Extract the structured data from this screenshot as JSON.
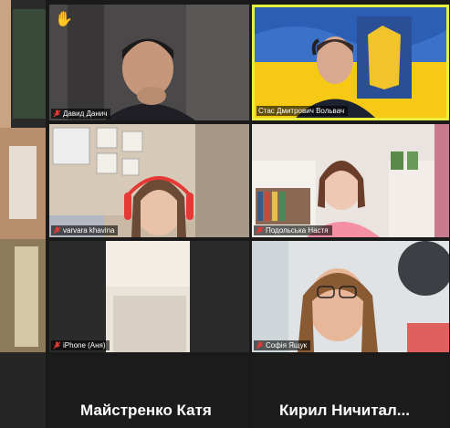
{
  "tiles": [
    {
      "name": "Давид Данич",
      "muted": true,
      "raised_hand": true,
      "active": false
    },
    {
      "name": "Стас Дмитрович Вольвач",
      "muted": false,
      "raised_hand": false,
      "active": true
    },
    {
      "name": "varvara khavina",
      "muted": true,
      "raised_hand": false,
      "active": false
    },
    {
      "name": "Подольська Настя",
      "muted": true,
      "raised_hand": false,
      "active": false
    },
    {
      "name": "iPhone (Аня)",
      "muted": true,
      "raised_hand": false,
      "active": false
    },
    {
      "name": "Софія Ящук",
      "muted": true,
      "raised_hand": false,
      "active": false
    }
  ],
  "video_off_tiles": [
    {
      "name": "Майстренко Катя"
    },
    {
      "name": "Кирил  Ничитал..."
    }
  ],
  "colors": {
    "active_border": "#e8ef3c",
    "muted_icon": "#e53935",
    "background": "#1a1a1a",
    "flag_blue": "#2c5fb4",
    "flag_yellow": "#f6c915"
  },
  "icons": {
    "muted": "mic-muted-icon",
    "hand": "raised-hand-icon"
  }
}
